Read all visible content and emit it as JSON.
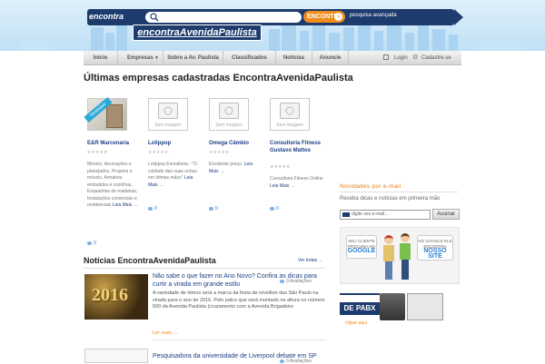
{
  "header": {
    "logo_small": "encontra",
    "logo_text": "encontraAvenidaPaulista",
    "search_placeholder": "",
    "search_button": "ENCONTRA",
    "advanced_search": "pesquisa avançada"
  },
  "nav": {
    "items": [
      "Início",
      "Empresas",
      "Sobre a Av. Paulista",
      "Classificados",
      "Notícias",
      "Anuncie"
    ],
    "login": "Login",
    "signup": "Cadastre-se"
  },
  "companies": {
    "heading": "Últimas empresas cadastradas EncontraAvenidaPaulista",
    "placeholder_label": "Sem imagem",
    "badge": "Destaque",
    "stars": "★★★★★",
    "items": [
      {
        "name": "E&R Marcenaria",
        "description": "Móveis, decorações e planejados, Projetos e móveis, Armários embutidos e cozinhas, Esquadrias de madeiras, Instalações comerciais e residenciais",
        "more": "Leia Mais →",
        "comments": "0"
      },
      {
        "name": "Lolippop",
        "description": "Lolippop Esmalteria - \"O cuidado das suas unhas em ótimas mãos\"",
        "more": "Leia Mais →",
        "comments": "0"
      },
      {
        "name": "Omega Câmbio",
        "description": "Excelente preço.",
        "more": "Leia Mais →",
        "comments": "0"
      },
      {
        "name": "Consultoria Fitness Gustavo Mattos",
        "description": "Consultoria Fitness Online",
        "more": "Leia Mais →",
        "comments": "0"
      }
    ]
  },
  "news": {
    "heading": "Notícias EncontraAvenidaPaulista",
    "see_all": "Ver todas →",
    "items": [
      {
        "title": "Não sabe o que fazer no Ano Novo? Confira as dicas para curtir a virada em grande estilo",
        "ratings": "0 Avaliações",
        "text": "A variedade de ritmos será a marca da festa de réveillon das São Paulo na virada para o ano de 2016. Pelo palco que será montado na altura no número 500 da Avenida Paulista (cruzamento com a Avenida Brigadeiro",
        "more": "Ler mais →",
        "image_label": "2016"
      },
      {
        "title": "Pesquisadora da universidade de Liverpool debate em SP",
        "ratings": "0 Avaliações"
      }
    ]
  },
  "sidebar": {
    "newsletter_heading": "Novidades por e-mail",
    "newsletter_text": "Receba dicas e notícias em primeira mão",
    "email_placeholder": "digite seu e-mail...",
    "subscribe": "Assinar",
    "ad1": {
      "left_bubble": "SEU CLIENTE PROCURA NO",
      "left_word": "GOOGLE",
      "right_bubble": "NO GOOGLE ELE ENCONTRA",
      "right_word": "NOSSO SITE"
    },
    "ad2": {
      "line1": "",
      "line2": "DE PABX",
      "line3": "clique aqui"
    }
  },
  "colors": {
    "brand_blue": "#1e3b6e",
    "link_blue": "#1c3f84",
    "accent_orange": "#f28c1a"
  }
}
